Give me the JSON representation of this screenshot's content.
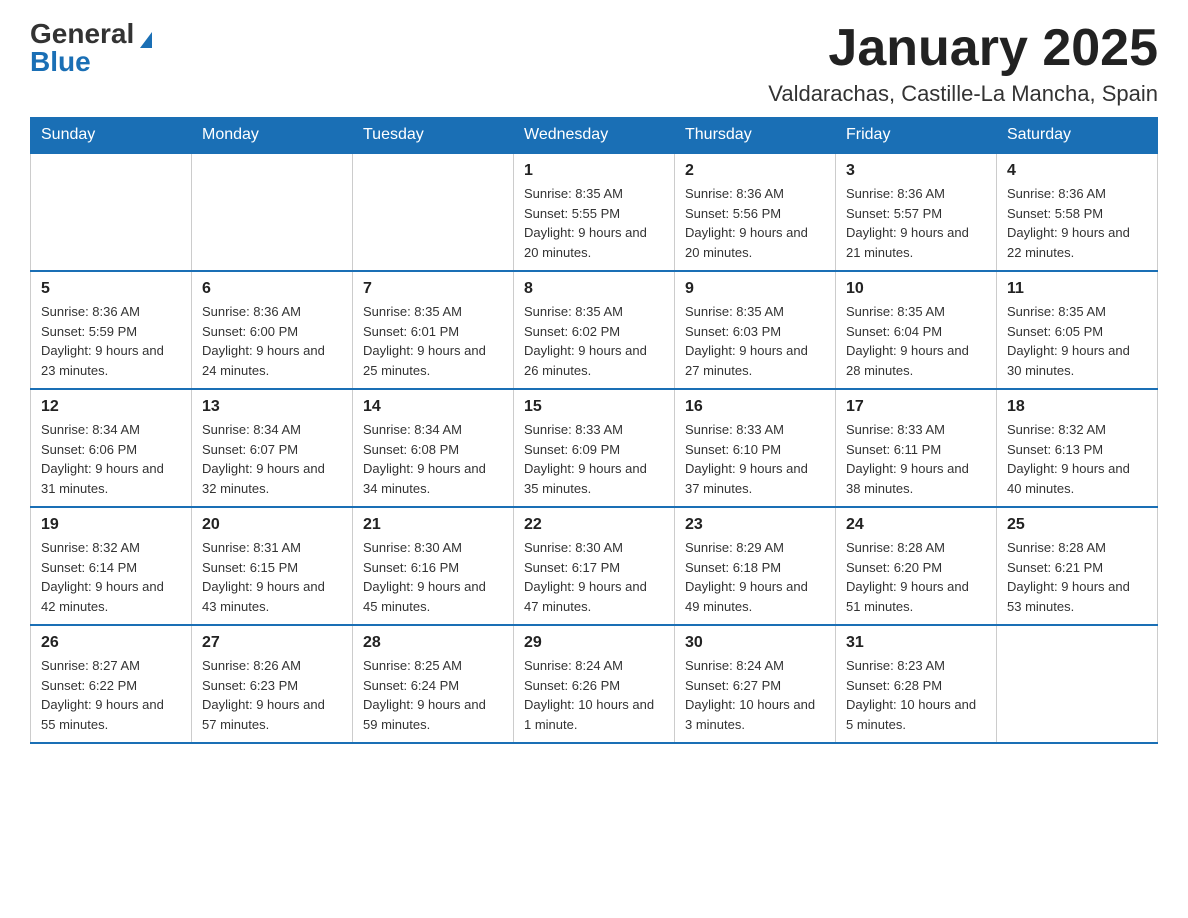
{
  "header": {
    "logo_general": "General",
    "logo_blue": "Blue",
    "title": "January 2025",
    "subtitle": "Valdarachas, Castille-La Mancha, Spain"
  },
  "days_of_week": [
    "Sunday",
    "Monday",
    "Tuesday",
    "Wednesday",
    "Thursday",
    "Friday",
    "Saturday"
  ],
  "weeks": [
    {
      "cells": [
        {
          "empty": true
        },
        {
          "empty": true
        },
        {
          "empty": true
        },
        {
          "day": 1,
          "sunrise": "8:35 AM",
          "sunset": "5:55 PM",
          "daylight": "9 hours and 20 minutes."
        },
        {
          "day": 2,
          "sunrise": "8:36 AM",
          "sunset": "5:56 PM",
          "daylight": "9 hours and 20 minutes."
        },
        {
          "day": 3,
          "sunrise": "8:36 AM",
          "sunset": "5:57 PM",
          "daylight": "9 hours and 21 minutes."
        },
        {
          "day": 4,
          "sunrise": "8:36 AM",
          "sunset": "5:58 PM",
          "daylight": "9 hours and 22 minutes."
        }
      ]
    },
    {
      "cells": [
        {
          "day": 5,
          "sunrise": "8:36 AM",
          "sunset": "5:59 PM",
          "daylight": "9 hours and 23 minutes."
        },
        {
          "day": 6,
          "sunrise": "8:36 AM",
          "sunset": "6:00 PM",
          "daylight": "9 hours and 24 minutes."
        },
        {
          "day": 7,
          "sunrise": "8:35 AM",
          "sunset": "6:01 PM",
          "daylight": "9 hours and 25 minutes."
        },
        {
          "day": 8,
          "sunrise": "8:35 AM",
          "sunset": "6:02 PM",
          "daylight": "9 hours and 26 minutes."
        },
        {
          "day": 9,
          "sunrise": "8:35 AM",
          "sunset": "6:03 PM",
          "daylight": "9 hours and 27 minutes."
        },
        {
          "day": 10,
          "sunrise": "8:35 AM",
          "sunset": "6:04 PM",
          "daylight": "9 hours and 28 minutes."
        },
        {
          "day": 11,
          "sunrise": "8:35 AM",
          "sunset": "6:05 PM",
          "daylight": "9 hours and 30 minutes."
        }
      ]
    },
    {
      "cells": [
        {
          "day": 12,
          "sunrise": "8:34 AM",
          "sunset": "6:06 PM",
          "daylight": "9 hours and 31 minutes."
        },
        {
          "day": 13,
          "sunrise": "8:34 AM",
          "sunset": "6:07 PM",
          "daylight": "9 hours and 32 minutes."
        },
        {
          "day": 14,
          "sunrise": "8:34 AM",
          "sunset": "6:08 PM",
          "daylight": "9 hours and 34 minutes."
        },
        {
          "day": 15,
          "sunrise": "8:33 AM",
          "sunset": "6:09 PM",
          "daylight": "9 hours and 35 minutes."
        },
        {
          "day": 16,
          "sunrise": "8:33 AM",
          "sunset": "6:10 PM",
          "daylight": "9 hours and 37 minutes."
        },
        {
          "day": 17,
          "sunrise": "8:33 AM",
          "sunset": "6:11 PM",
          "daylight": "9 hours and 38 minutes."
        },
        {
          "day": 18,
          "sunrise": "8:32 AM",
          "sunset": "6:13 PM",
          "daylight": "9 hours and 40 minutes."
        }
      ]
    },
    {
      "cells": [
        {
          "day": 19,
          "sunrise": "8:32 AM",
          "sunset": "6:14 PM",
          "daylight": "9 hours and 42 minutes."
        },
        {
          "day": 20,
          "sunrise": "8:31 AM",
          "sunset": "6:15 PM",
          "daylight": "9 hours and 43 minutes."
        },
        {
          "day": 21,
          "sunrise": "8:30 AM",
          "sunset": "6:16 PM",
          "daylight": "9 hours and 45 minutes."
        },
        {
          "day": 22,
          "sunrise": "8:30 AM",
          "sunset": "6:17 PM",
          "daylight": "9 hours and 47 minutes."
        },
        {
          "day": 23,
          "sunrise": "8:29 AM",
          "sunset": "6:18 PM",
          "daylight": "9 hours and 49 minutes."
        },
        {
          "day": 24,
          "sunrise": "8:28 AM",
          "sunset": "6:20 PM",
          "daylight": "9 hours and 51 minutes."
        },
        {
          "day": 25,
          "sunrise": "8:28 AM",
          "sunset": "6:21 PM",
          "daylight": "9 hours and 53 minutes."
        }
      ]
    },
    {
      "cells": [
        {
          "day": 26,
          "sunrise": "8:27 AM",
          "sunset": "6:22 PM",
          "daylight": "9 hours and 55 minutes."
        },
        {
          "day": 27,
          "sunrise": "8:26 AM",
          "sunset": "6:23 PM",
          "daylight": "9 hours and 57 minutes."
        },
        {
          "day": 28,
          "sunrise": "8:25 AM",
          "sunset": "6:24 PM",
          "daylight": "9 hours and 59 minutes."
        },
        {
          "day": 29,
          "sunrise": "8:24 AM",
          "sunset": "6:26 PM",
          "daylight": "10 hours and 1 minute."
        },
        {
          "day": 30,
          "sunrise": "8:24 AM",
          "sunset": "6:27 PM",
          "daylight": "10 hours and 3 minutes."
        },
        {
          "day": 31,
          "sunrise": "8:23 AM",
          "sunset": "6:28 PM",
          "daylight": "10 hours and 5 minutes."
        },
        {
          "empty": true
        }
      ]
    }
  ]
}
